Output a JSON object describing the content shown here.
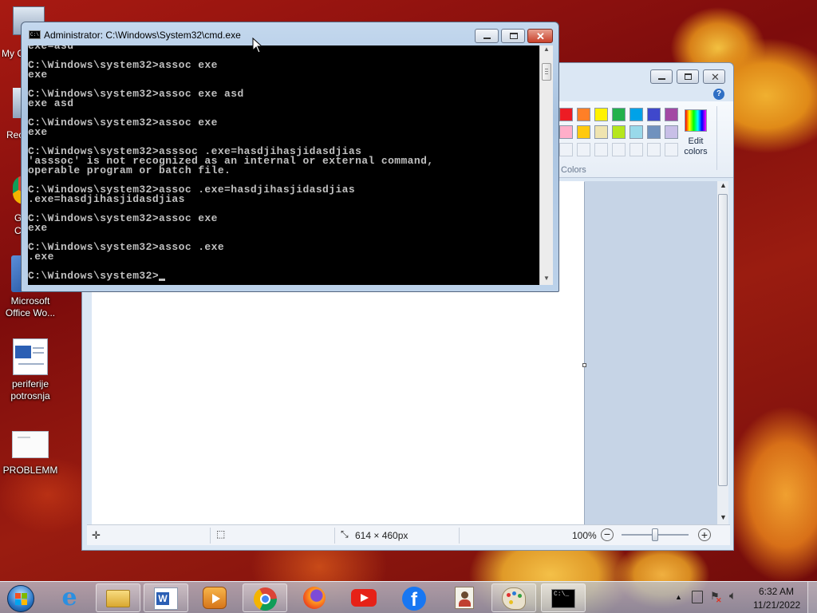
{
  "desktop": {
    "icons": [
      {
        "label": "Microsoft Office Wo...",
        "icon": "word-app-icon"
      },
      {
        "label": "periferije potrosnja",
        "icon": "word-document-icon"
      },
      {
        "label": "PROBLEMM",
        "icon": "image-file-icon"
      }
    ],
    "partial_labels": [
      "My C",
      "Rec",
      "G",
      "C"
    ]
  },
  "cmd_window": {
    "title": "Administrator: C:\\Windows\\System32\\cmd.exe",
    "lines": [
      "exe=asd",
      "",
      "C:\\Windows\\system32>assoc exe",
      "exe",
      "",
      "C:\\Windows\\system32>assoc exe asd",
      "exe asd",
      "",
      "C:\\Windows\\system32>assoc exe",
      "exe",
      "",
      "C:\\Windows\\system32>asssoc .exe=hasdjihasjidasdjias",
      "'asssoc' is not recognized as an internal or external command,",
      "operable program or batch file.",
      "",
      "C:\\Windows\\system32>assoc .exe=hasdjihasjidasdjias",
      ".exe=hasdjihasjidasdjias",
      "",
      "C:\\Windows\\system32>assoc exe",
      "exe",
      "",
      "C:\\Windows\\system32>assoc .exe",
      ".exe",
      "",
      "C:\\Windows\\system32>"
    ]
  },
  "paint_window": {
    "edit_colors_label": "Edit colors",
    "colors_group_label": "Colors",
    "palette_row1": [
      "#ed1c24",
      "#ff7f27",
      "#fff200",
      "#22b14c",
      "#00a2e8",
      "#3f48cc",
      "#a349a4"
    ],
    "palette_row2": [
      "#ffaec9",
      "#ffc90e",
      "#efe4b0",
      "#b5e61d",
      "#99d9ea",
      "#7092be",
      "#c8bfe7"
    ],
    "status_size": "614 × 460px",
    "zoom": "100%"
  },
  "taskbar": {
    "apps": [
      "start-button",
      "internet-explorer",
      "file-explorer",
      "word",
      "media-center",
      "chrome",
      "firefox",
      "youtube",
      "facebook",
      "contact-app",
      "paint",
      "cmd"
    ],
    "time": "6:32 AM",
    "date": "11/21/2022"
  },
  "colors": {
    "accent": "#4a8fd6",
    "console_bg": "#000000",
    "console_fg": "#c0c0c0"
  }
}
